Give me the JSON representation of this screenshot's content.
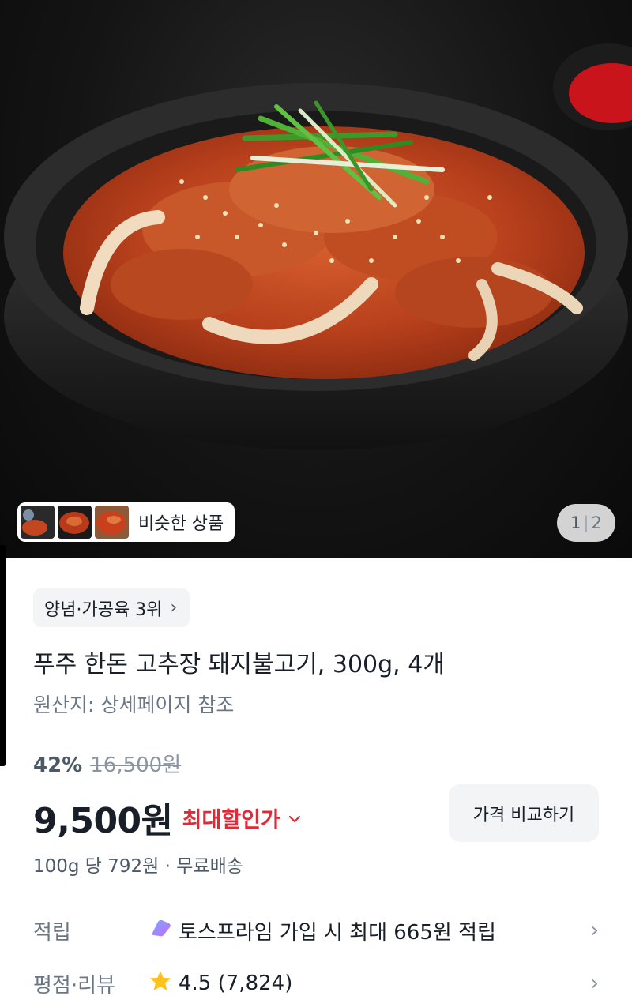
{
  "gallery": {
    "similar_label": "비슷한 상품",
    "page_current": "1",
    "page_separator": "|",
    "page_total": "2"
  },
  "product": {
    "category_badge": "양념·가공육 3위",
    "title": "푸주 한돈 고추장 돼지불고기, 300g, 4개",
    "origin": "원산지: 상세페이지 참조",
    "discount_rate": "42%",
    "original_price": "16,500원",
    "sale_price": "9,500원",
    "max_discount_label": "최대할인가",
    "compare_button": "가격 비교하기",
    "unit_price": "100g 당 792원 · 무료배송"
  },
  "points": {
    "label": "적립",
    "value": "토스프라임 가입 시 최대 665원 적립"
  },
  "rating": {
    "label": "평점·리뷰",
    "value": "4.5 (7,824)"
  },
  "colors": {
    "accent_red": "#e02a37",
    "star": "#ffc21a",
    "badge_bg": "#f2f4f6"
  }
}
